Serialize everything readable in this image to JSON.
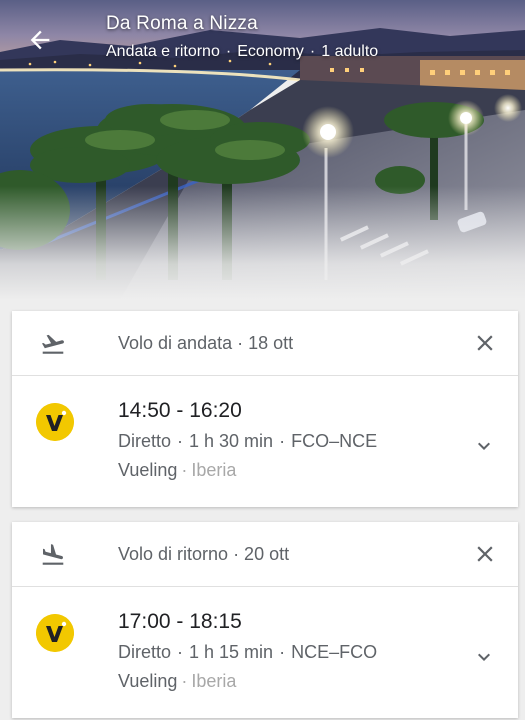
{
  "header": {
    "title": "Da Roma a Nizza",
    "trip_type": "Andata e ritorno",
    "cabin": "Economy",
    "passengers": "1 adulto",
    "separator": "·",
    "back_icon": "arrow-back-icon"
  },
  "flights": {
    "outbound": {
      "label": "Volo di andata · 18 ott",
      "times": "14:50 - 16:20",
      "stops": "Diretto",
      "duration": "1 h 30 min",
      "route": "FCO–NCE",
      "carrier": "Vueling",
      "partner": "Iberia",
      "icon": "flight-takeoff-icon"
    },
    "return": {
      "label": "Volo di ritorno · 20 ott",
      "times": "17:00 - 18:15",
      "stops": "Diretto",
      "duration": "1 h 15 min",
      "route": "NCE–FCO",
      "carrier": "Vueling",
      "partner": "Iberia",
      "icon": "flight-land-icon"
    }
  },
  "colors": {
    "background": "#eeeeee",
    "card": "#ffffff",
    "logo_yellow": "#f2c800",
    "text_primary": "#202124",
    "text_secondary": "#5f6368",
    "text_muted": "#a8a8a8"
  }
}
